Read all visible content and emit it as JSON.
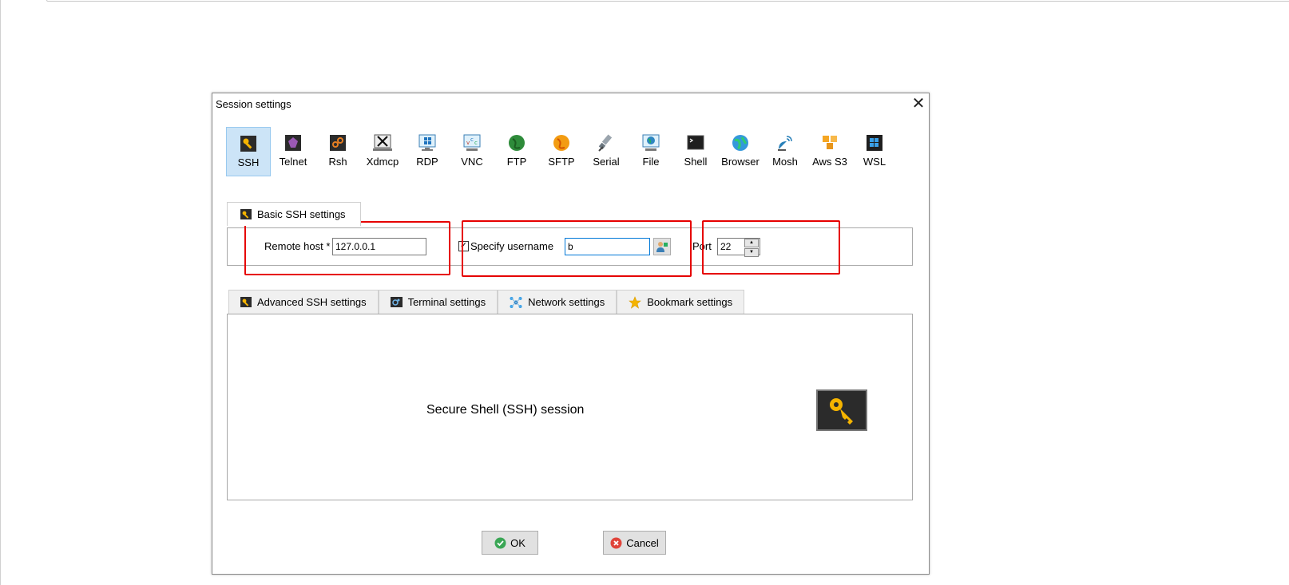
{
  "dialog": {
    "title": "Session settings",
    "close_symbol": "✕"
  },
  "session_types": [
    {
      "label": "SSH",
      "icon": "key-icon",
      "selected": true
    },
    {
      "label": "Telnet",
      "icon": "telnet-icon"
    },
    {
      "label": "Rsh",
      "icon": "rsh-icon"
    },
    {
      "label": "Xdmcp",
      "icon": "x-icon"
    },
    {
      "label": "RDP",
      "icon": "rdp-monitor-icon"
    },
    {
      "label": "VNC",
      "icon": "vnc-monitor-icon"
    },
    {
      "label": "FTP",
      "icon": "ftp-globe-icon"
    },
    {
      "label": "SFTP",
      "icon": "sftp-globe-icon"
    },
    {
      "label": "Serial",
      "icon": "serial-plug-icon"
    },
    {
      "label": "File",
      "icon": "file-monitor-icon"
    },
    {
      "label": "Shell",
      "icon": "shell-terminal-icon"
    },
    {
      "label": "Browser",
      "icon": "browser-globe-icon"
    },
    {
      "label": "Mosh",
      "icon": "mosh-satellite-icon"
    },
    {
      "label": "Aws S3",
      "icon": "aws-s3-icon"
    },
    {
      "label": "WSL",
      "icon": "wsl-windows-icon"
    }
  ],
  "basic": {
    "tab_label": "Basic SSH settings",
    "remote_host_label": "Remote host *",
    "remote_host_value": "127.0.0.1",
    "specify_username_label": "Specify username",
    "specify_username_checked": true,
    "checkbox_mark": "✓",
    "username_value": "b",
    "port_label": "Port",
    "port_value": "22",
    "spin_up": "▲",
    "spin_down": "▼"
  },
  "tabs": [
    {
      "label": "Advanced SSH settings",
      "icon": "key-icon"
    },
    {
      "label": "Terminal settings",
      "icon": "terminal-icon"
    },
    {
      "label": "Network settings",
      "icon": "network-icon"
    },
    {
      "label": "Bookmark settings",
      "icon": "star-icon"
    }
  ],
  "content": {
    "description": "Secure Shell (SSH) session"
  },
  "buttons": {
    "ok_label": "OK",
    "cancel_label": "Cancel"
  },
  "colors": {
    "selection": "#cce4f7",
    "annotation_red": "#e60000",
    "ok_green": "#3aa655",
    "cancel_red": "#e0443a",
    "key_gold": "#f5b400"
  }
}
